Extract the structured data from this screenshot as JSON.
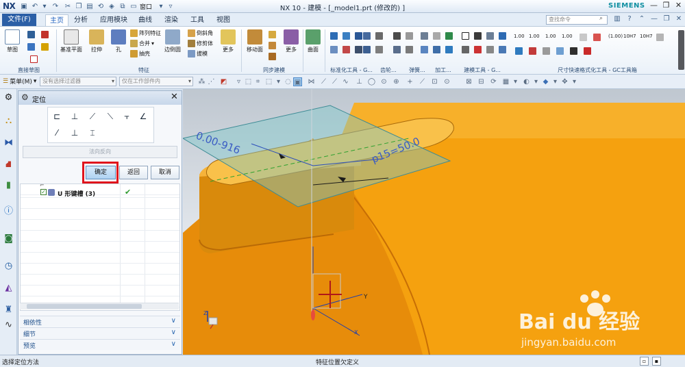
{
  "titlebar": {
    "logo": "NX",
    "title": "NX 10 - 建模 - [_model1.prt (修改的) ]",
    "window_menu": "窗口",
    "brand": "SIEMENS"
  },
  "tabs": {
    "file": "文件(F)",
    "items": [
      "主页",
      "分析",
      "应用模块",
      "曲线",
      "渲染",
      "工具",
      "视图"
    ],
    "active": "主页",
    "search_placeholder": "查找命令"
  },
  "ribbon": {
    "sketch": "草图",
    "datum_plane": "基准平面",
    "extrude": "拉伸",
    "hole": "孔",
    "pattern_feature": "阵列特征",
    "unite": "合并",
    "shell": "抽壳",
    "edge_blend": "边倒圆",
    "chamfer": "倒斜角",
    "trim_body": "修剪体",
    "draft": "拔模",
    "more": "更多",
    "move_face": "移动面",
    "more2": "更多",
    "surface": "曲面",
    "groups": {
      "direct_sketch": "直接草图",
      "feature": "特征",
      "sync_modeling": "同步建模",
      "std_parts": "标准化工具 - G...",
      "gear": "齿轮...",
      "spring": "弹簧...",
      "machining": "加工...",
      "modeling_tools": "建模工具 - G...",
      "dim_tools": "尺寸快速格式化工具 - GC工具箱"
    },
    "tolerance_labels": [
      "1.00",
      "1.00",
      "1.00",
      "1.00",
      "(1.00)",
      "10H7",
      "10H7"
    ]
  },
  "selection_bar": {
    "menu": "菜单(M)",
    "filter_placeholder": "没有选择过滤器",
    "scope_placeholder": "仅在工作部件内"
  },
  "dialog": {
    "title": "定位",
    "reverse_direction": "法向反向",
    "ok": "确定",
    "back": "返回",
    "cancel": "取消",
    "tree_item": "U 形键槽 (3)",
    "sections": [
      "相依性",
      "细节",
      "预览"
    ]
  },
  "viewport": {
    "dim_left": "0.00-916",
    "dim_right": "p15=50.0",
    "axis_y": "Y",
    "axis_z": "Z",
    "axis_x": "X"
  },
  "status": {
    "left": "选择定位方法",
    "mid": "特征位置欠定义"
  },
  "watermark": {
    "brand": "Bai du 经验",
    "url": "jingyan.baidu.com"
  },
  "colors": {
    "part_orange": "#f5a10f",
    "sketch_plane": "#7fc7c9",
    "dimension_blue": "#2a4dbb",
    "highlight_red": "#e0141c"
  }
}
